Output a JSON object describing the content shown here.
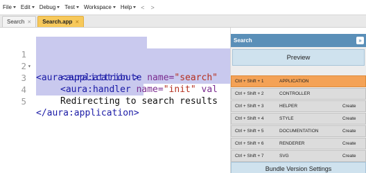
{
  "menu": {
    "items": [
      "File",
      "Edit",
      "Debug",
      "Test",
      "Workspace",
      "Help"
    ],
    "back": "<",
    "forward": ">"
  },
  "tabs": [
    {
      "label": "Search",
      "active": false
    },
    {
      "label": "Search.app",
      "active": true
    }
  ],
  "editor": {
    "lines": [
      {
        "num": "1",
        "fold": "▾"
      },
      {
        "num": "2",
        "fold": ""
      },
      {
        "num": "3",
        "fold": ""
      },
      {
        "num": "4",
        "fold": ""
      },
      {
        "num": "5",
        "fold": ""
      }
    ],
    "l1_tag": "<aura:application >",
    "l2_tag_open": "<aura:attribute ",
    "l2_attr": "name=",
    "l2_str": "\"search\"",
    "l3_tag_open": "<aura:handler ",
    "l3_attr": "name=",
    "l3_str": "\"init\"",
    "l3_tail": " val",
    "l4_text": "Redirecting to search results",
    "l5_tag": "</aura:application>"
  },
  "panel": {
    "title": "Search",
    "collapse": "»",
    "preview_label": "Preview",
    "rows": [
      {
        "shortcut": "Ctrl + Shift + 1",
        "name": "APPLICATION",
        "create": "",
        "active": true
      },
      {
        "shortcut": "Ctrl + Shift + 2",
        "name": "CONTROLLER",
        "create": "",
        "active": false
      },
      {
        "shortcut": "Ctrl + Shift + 3",
        "name": "HELPER",
        "create": "Create",
        "active": false
      },
      {
        "shortcut": "Ctrl + Shift + 4",
        "name": "STYLE",
        "create": "Create",
        "active": false
      },
      {
        "shortcut": "Ctrl + Shift + 5",
        "name": "DOCUMENTATION",
        "create": "Create",
        "active": false
      },
      {
        "shortcut": "Ctrl + Shift + 6",
        "name": "RENDERER",
        "create": "Create",
        "active": false
      },
      {
        "shortcut": "Ctrl + Shift + 7",
        "name": "SVG",
        "create": "Create",
        "active": false
      }
    ],
    "bundle_label": "Bundle Version Settings"
  },
  "colors": {
    "panel_header": "#5a8fb8",
    "active_tab": "#f7c95b",
    "active_row": "#f4a256",
    "selection": "#c9c9ee"
  }
}
